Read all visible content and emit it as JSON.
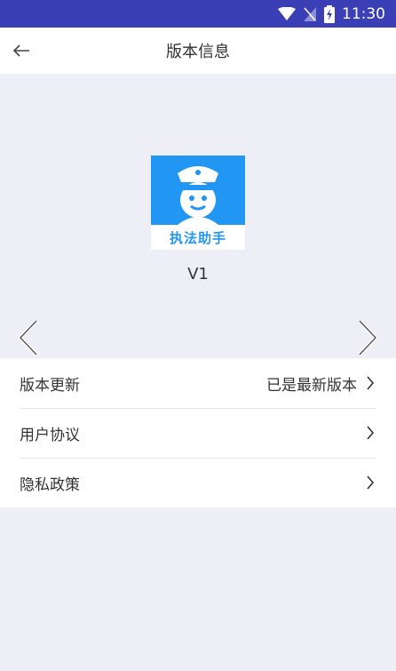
{
  "status_bar": {
    "time": "11:30",
    "icons": [
      "wifi-icon",
      "no-sim-icon",
      "battery-charging-icon"
    ]
  },
  "header": {
    "title": "版本信息",
    "back_icon": "back-arrow-icon"
  },
  "app": {
    "logo_text": "执法助手",
    "version": "V1",
    "brand_color": "#2196f3"
  },
  "carousel": {
    "prev_icon": "chevron-left-icon",
    "next_icon": "chevron-right-icon"
  },
  "menu": {
    "items": [
      {
        "label": "版本更新",
        "value": "已是最新版本"
      },
      {
        "label": "用户协议",
        "value": ""
      },
      {
        "label": "隐私政策",
        "value": ""
      }
    ]
  },
  "colors": {
    "status_bar": "#3b3fb6",
    "background": "#eeeef6"
  }
}
